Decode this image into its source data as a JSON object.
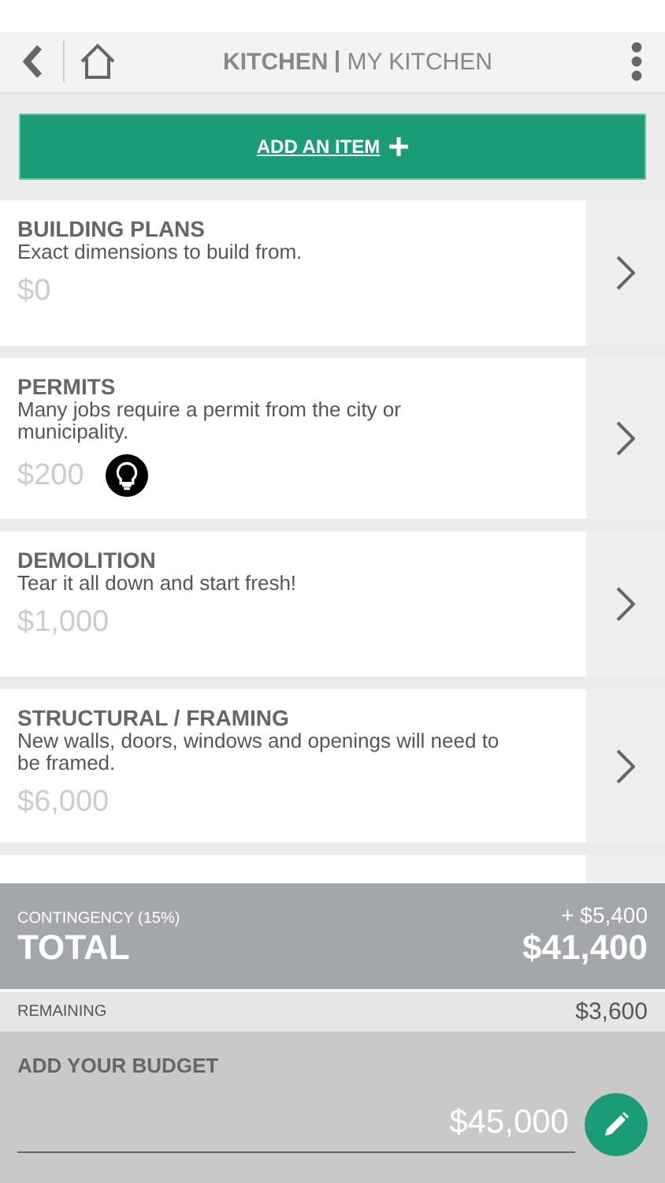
{
  "header": {
    "title": "KITCHEN",
    "subtitle": "MY KITCHEN"
  },
  "add_button": {
    "label": "ADD AN ITEM"
  },
  "items": [
    {
      "title": "BUILDING PLANS",
      "description": "Exact dimensions to build from.",
      "price": "$0",
      "tip": false
    },
    {
      "title": "PERMITS",
      "description": "Many jobs require a permit from the city or municipality.",
      "price": "$200",
      "tip": true
    },
    {
      "title": "DEMOLITION",
      "description": "Tear it all down and start fresh!",
      "price": "$1,000",
      "tip": false
    },
    {
      "title": "STRUCTURAL / FRAMING",
      "description": "New walls, doors, windows and openings will need to be framed.",
      "price": "$6,000",
      "tip": false
    }
  ],
  "summary": {
    "contingency_label": "CONTINGENCY (15%)",
    "contingency_value": "+ $5,400",
    "total_label": "TOTAL",
    "total_value": "$41,400",
    "remaining_label": "REMAINING",
    "remaining_value": "$3,600"
  },
  "budget": {
    "label": "ADD YOUR BUDGET",
    "value": "$45,000"
  }
}
